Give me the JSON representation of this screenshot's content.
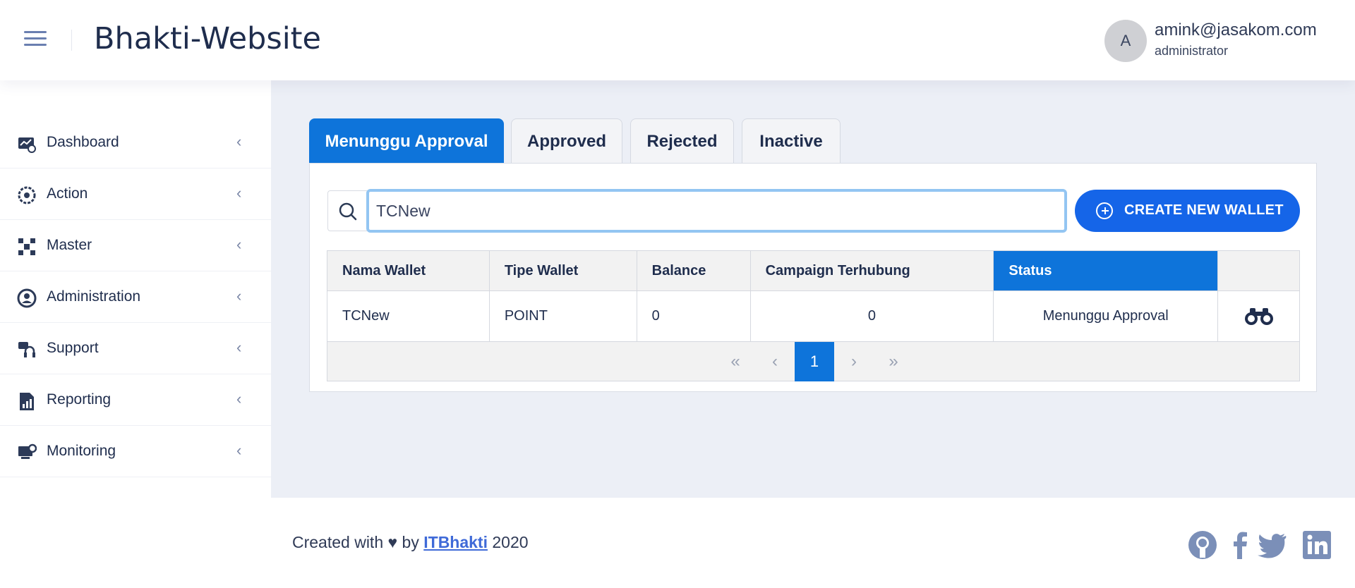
{
  "header": {
    "title": "Bhakti-Website",
    "avatar_initial": "A",
    "user_email": "amink@jasakom.com",
    "user_role": "administrator"
  },
  "sidebar": {
    "items": [
      {
        "label": "Dashboard",
        "icon": "dashboard-icon"
      },
      {
        "label": "Action",
        "icon": "gears-icon"
      },
      {
        "label": "Master",
        "icon": "network-icon"
      },
      {
        "label": "Administration",
        "icon": "user-gear-icon"
      },
      {
        "label": "Support",
        "icon": "headset-icon"
      },
      {
        "label": "Reporting",
        "icon": "report-icon"
      },
      {
        "label": "Monitoring",
        "icon": "monitor-gear-icon"
      }
    ]
  },
  "tabs": [
    {
      "label": "Menunggu Approval",
      "active": true
    },
    {
      "label": "Approved",
      "active": false
    },
    {
      "label": "Rejected",
      "active": false
    },
    {
      "label": "Inactive",
      "active": false
    }
  ],
  "search": {
    "value": "TCNew",
    "placeholder": ""
  },
  "create_button": {
    "label": "CREATE NEW WALLET"
  },
  "table": {
    "columns": [
      "Nama Wallet",
      "Tipe Wallet",
      "Balance",
      "Campaign Terhubung",
      "Status",
      ""
    ],
    "sorted_column": "Status",
    "rows": [
      {
        "nama_wallet": "TCNew",
        "tipe_wallet": "POINT",
        "balance": "0",
        "campaign": "0",
        "status": "Menunggu Approval",
        "action_icon": "binoculars-icon"
      }
    ]
  },
  "pagination": {
    "first": "«",
    "prev": "‹",
    "current": "1",
    "next": "›",
    "last": "»"
  },
  "footer": {
    "prefix": "Created with ♥ by ",
    "link": "ITBhakti",
    "suffix": " 2020",
    "social": [
      "github-icon",
      "facebook-icon",
      "twitter-icon",
      "linkedin-icon"
    ]
  },
  "colors": {
    "primary": "#0e74da",
    "button": "#1565e8",
    "content_bg": "#eceff6",
    "icon_muted": "#7a86a6"
  }
}
